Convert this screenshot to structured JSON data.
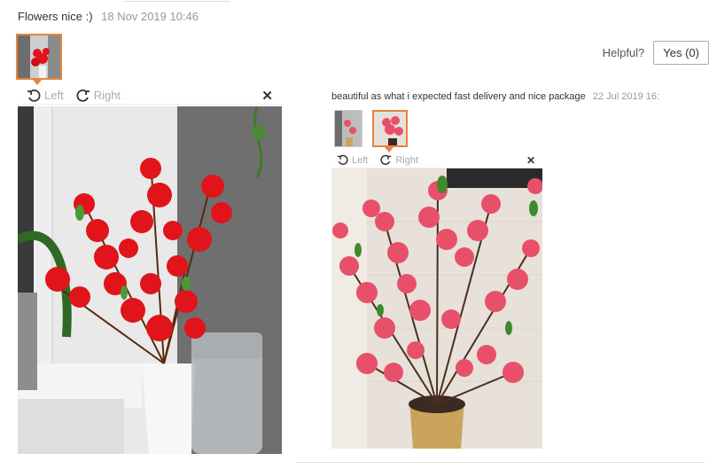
{
  "review1": {
    "text": "Flowers nice :)",
    "date": "18 Nov 2019 10:46",
    "viewer": {
      "left_label": "Left",
      "right_label": "Right",
      "close_glyph": "✕"
    }
  },
  "helpful": {
    "label": "Helpful?",
    "yes_button": "Yes (0)"
  },
  "review2": {
    "text": "beautiful as what i expected fast delivery and nice package",
    "date": "22 Jul 2019 16:",
    "viewer": {
      "left_label": "Left",
      "right_label": "Right",
      "close_glyph": "✕"
    }
  },
  "colors": {
    "accent": "#e7843c",
    "red_blossom": "#e0141a",
    "pink_blossom": "#e8506a"
  }
}
